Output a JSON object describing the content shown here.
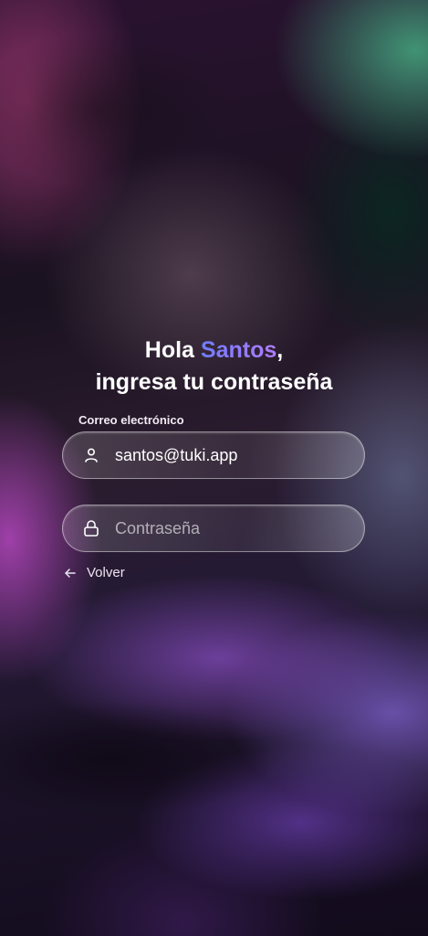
{
  "heading": {
    "greeting": "Hola",
    "name": "Santos",
    "comma": ",",
    "line2": "ingresa tu contraseña"
  },
  "email": {
    "label": "Correo electrónico",
    "value": "santos@tuki.app",
    "icon": "user-icon"
  },
  "password": {
    "placeholder": "Contraseña",
    "icon": "lock-icon"
  },
  "back": {
    "label": "Volver",
    "icon": "arrow-left-icon"
  },
  "colors": {
    "name_gradient_start": "#6f7cff",
    "name_gradient_end": "#b07cff",
    "text": "#ffffff"
  }
}
